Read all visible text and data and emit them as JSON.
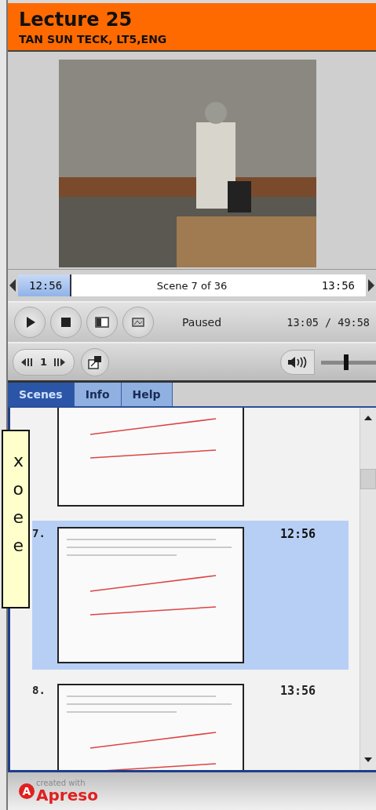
{
  "header": {
    "title": "Lecture 25",
    "subtitle": "TAN SUN TECK, LT5,ENG"
  },
  "scene_bar": {
    "start": "12:56",
    "label": "Scene 7 of 36",
    "end": "13:56",
    "level": 0.15
  },
  "controls": {
    "status": "Paused",
    "time": "13:05 / 49:58",
    "speed": "1",
    "volume": {
      "level": 0.45
    }
  },
  "tabs": [
    {
      "label": "Scenes",
      "selected": true
    },
    {
      "label": "Info",
      "selected": false
    },
    {
      "label": "Help",
      "selected": false
    }
  ],
  "scenes": [
    {
      "selected": false
    },
    {
      "number": "7.",
      "time": "12:56",
      "selected": true
    },
    {
      "number": "8.",
      "time": "13:56",
      "selected": false
    }
  ],
  "overlay": {
    "lines": [
      "x",
      "o",
      "e",
      "e"
    ]
  },
  "footer": {
    "logo_letter": "A",
    "credit": "created with",
    "brand": "Apreso"
  }
}
